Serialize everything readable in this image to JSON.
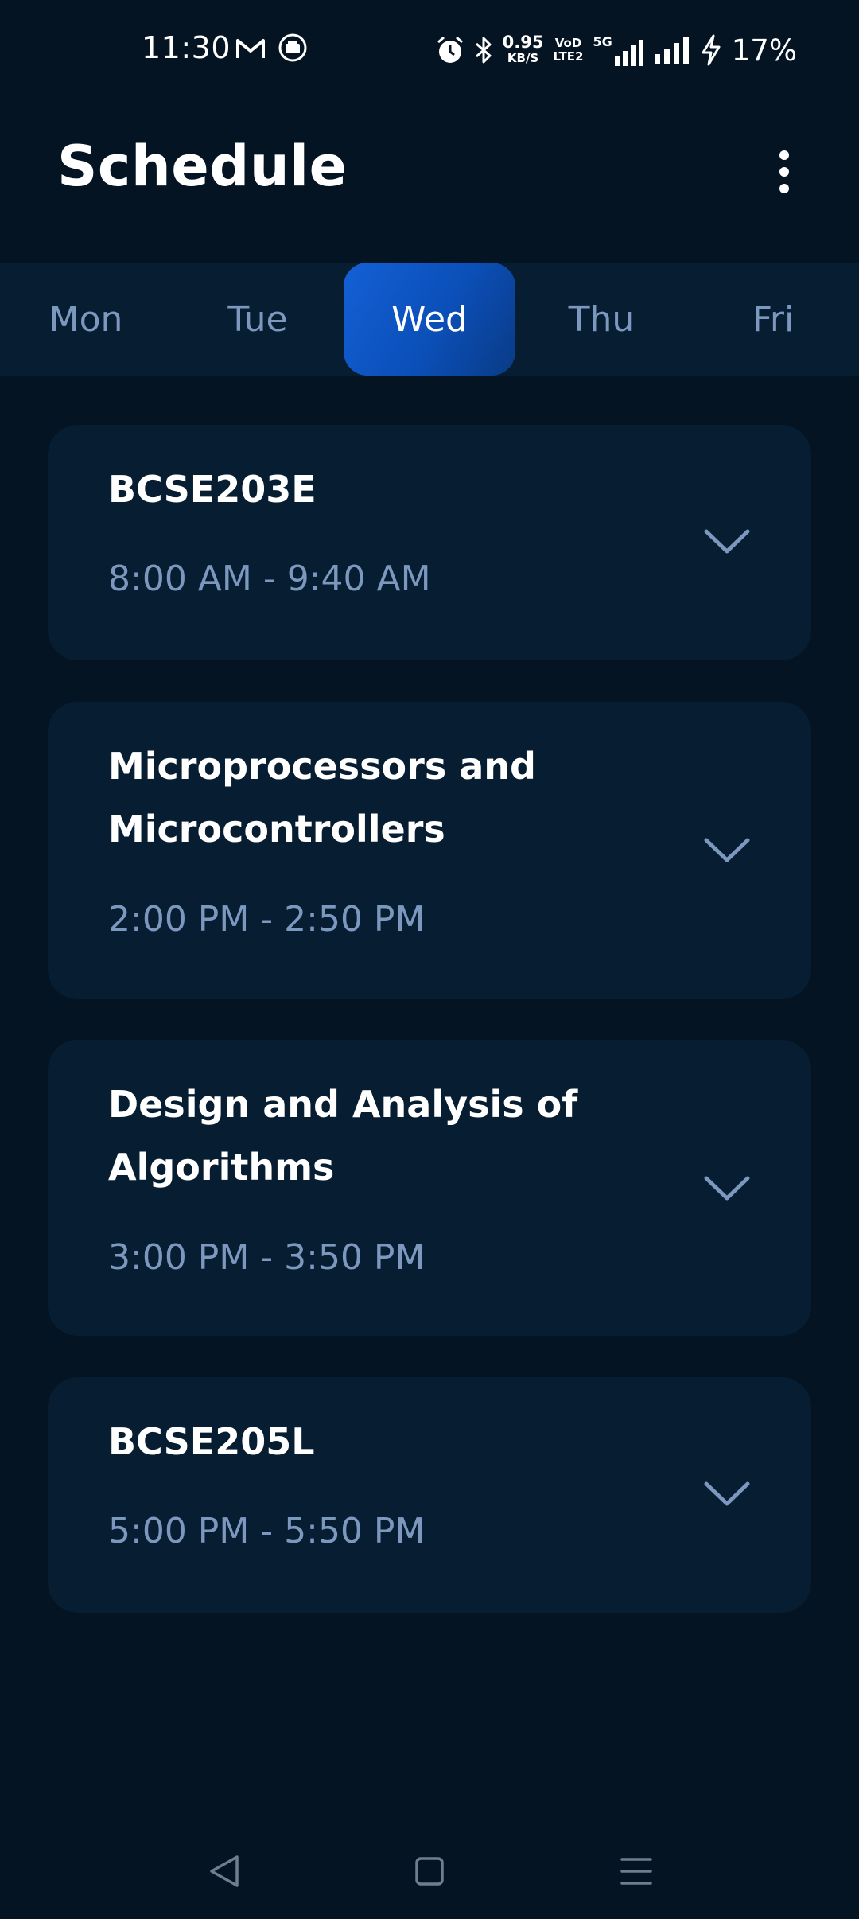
{
  "status_bar": {
    "time": "11:30",
    "net_speed_value": "0.95",
    "net_speed_unit": "KB/S",
    "volte_top": "VoD",
    "volte_bottom": "LTE2",
    "net_type": "5G",
    "battery": "17%",
    "icons": [
      "gmail-icon",
      "app-notification-icon",
      "alarm-icon",
      "bluetooth-icon",
      "signal-icon",
      "charging-icon"
    ]
  },
  "header": {
    "title": "Schedule",
    "menu_icon": "more-vertical-icon"
  },
  "days": {
    "selected": "Wed",
    "items": [
      "Mon",
      "Tue",
      "Wed",
      "Thu",
      "Fri"
    ]
  },
  "classes": [
    {
      "title_lines": [
        "BCSE203E"
      ],
      "time": "8:00 AM - 9:40 AM"
    },
    {
      "title_lines": [
        "Microprocessors and",
        "Microcontrollers"
      ],
      "time": "2:00 PM - 2:50 PM"
    },
    {
      "title_lines": [
        "Design and Analysis of",
        "Algorithms"
      ],
      "time": "3:00 PM - 3:50 PM"
    },
    {
      "title_lines": [
        "BCSE205L"
      ],
      "time": "5:00 PM - 5:50 PM"
    }
  ],
  "colors": {
    "background": "#051422",
    "card": "#071d31",
    "accent": "#1360d6",
    "muted_text": "#7c98bf"
  },
  "nav_bar": {
    "icons": [
      "back-icon",
      "home-icon",
      "recents-icon"
    ]
  }
}
